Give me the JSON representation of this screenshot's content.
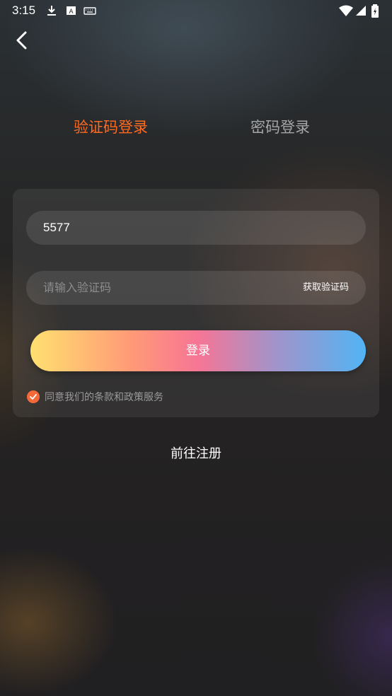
{
  "status_bar": {
    "time": "3:15",
    "icons": [
      "download-icon",
      "a-box-icon",
      "keyboard-icon",
      "wifi-icon",
      "signal-icon",
      "battery-icon"
    ]
  },
  "nav": {
    "back_icon": "chevron-left-icon"
  },
  "tabs": [
    {
      "label": "验证码登录",
      "active": true
    },
    {
      "label": "密码登录",
      "active": false
    }
  ],
  "form": {
    "phone_value": "5577",
    "code_placeholder": "请输入验证码",
    "get_code_label": "获取验证码",
    "login_label": "登录",
    "agree_label": "同意我们的条款和政策服务",
    "agree_checked": true
  },
  "register_label": "前往注册",
  "colors": {
    "accent": "#ff6a21",
    "check": "#f4693a",
    "button_gradient": [
      "#ffe070",
      "#f67595",
      "#52b4f4"
    ]
  }
}
